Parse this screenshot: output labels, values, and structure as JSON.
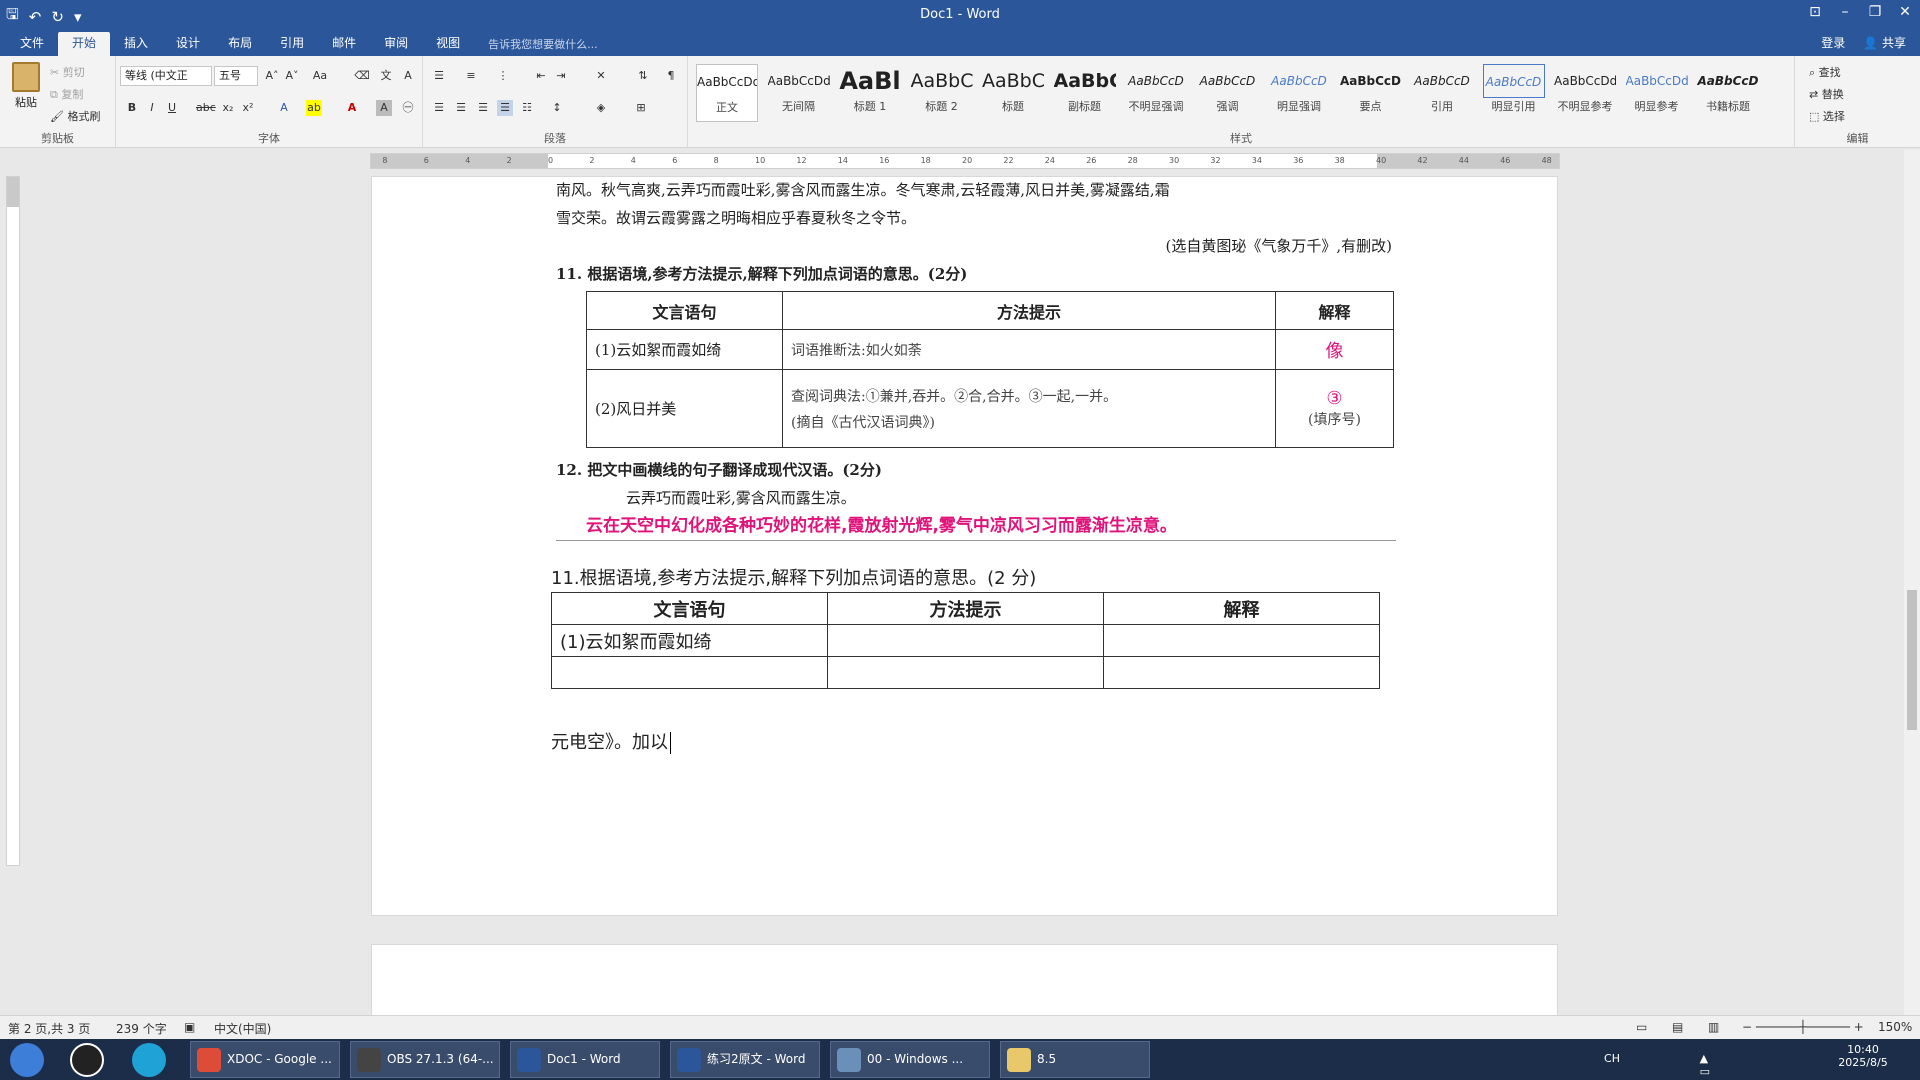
{
  "window": {
    "title": "Doc1 - Word"
  },
  "qat": {
    "save": "🖫",
    "undo": "↶",
    "redo": "↻",
    "more": "▾"
  },
  "win_controls": {
    "ribbon_opt": "⊡",
    "min": "–",
    "restore": "❐",
    "close": "✕"
  },
  "tabs": [
    "文件",
    "开始",
    "插入",
    "设计",
    "布局",
    "引用",
    "邮件",
    "审阅",
    "视图"
  ],
  "active_tab": "开始",
  "tell_me": "告诉我您想要做什么...",
  "account": {
    "signin": "登录",
    "share": "共享"
  },
  "clipboard": {
    "paste": "粘贴",
    "cut": "剪切",
    "copy": "复制",
    "painter": "格式刷",
    "label": "剪贴板"
  },
  "font": {
    "name": "等线 (中文正",
    "size": "五号",
    "label": "字体"
  },
  "paragraph": {
    "label": "段落"
  },
  "styles": {
    "label": "样式",
    "items": [
      {
        "preview": "AaBbCcDd",
        "name": "正文"
      },
      {
        "preview": "AaBbCcDd",
        "name": "无间隔"
      },
      {
        "preview": "AaBl",
        "name": "标题 1"
      },
      {
        "preview": "AaBbC",
        "name": "标题 2"
      },
      {
        "preview": "AaBbC",
        "name": "标题"
      },
      {
        "preview": "AaBbC",
        "name": "副标题"
      },
      {
        "preview": "AaBbCcD",
        "name": "不明显强调"
      },
      {
        "preview": "AaBbCcD",
        "name": "强调"
      },
      {
        "preview": "AaBbCcD",
        "name": "明显强调"
      },
      {
        "preview": "AaBbCcD",
        "name": "要点"
      },
      {
        "preview": "AaBbCcD",
        "name": "引用"
      },
      {
        "preview": "AaBbCcD",
        "name": "明显引用"
      },
      {
        "preview": "AaBbCcDd",
        "name": "不明显参考"
      },
      {
        "preview": "AaBbCcDd",
        "name": "明显参考"
      },
      {
        "preview": "AaBbCcD",
        "name": "书籍标题"
      }
    ]
  },
  "editing": {
    "find": "查找",
    "replace": "替换",
    "select": "选择",
    "label": "编辑"
  },
  "scan": {
    "line1": "南风。秋气高爽,云弄巧而霞吐彩,雾含风而露生凉。冬气寒肃,云轻霞薄,风日并美,雾凝露结,霜",
    "line2": "雪交荣。故谓云霞雾露之明晦相应乎春夏秋冬之令节。",
    "source": "(选自黄图珌《气象万千》,有删改)",
    "q11": "11. 根据语境,参考方法提示,解释下列加点词语的意思。(2分)",
    "table": {
      "headers": [
        "文言语句",
        "方法提示",
        "解释"
      ],
      "row1": {
        "sentence": "(1)云如絮而霞如绮",
        "hint": "词语推断法:如火如荼",
        "answer": "像"
      },
      "row2": {
        "sentence": "(2)风日并美",
        "hint": "查阅词典法:①兼并,吞并。②合,合并。③一起,一并。",
        "hint2": "(摘自《古代汉语词典》)",
        "answer": "③",
        "answer_note": "(填序号)"
      }
    },
    "q12": "12. 把文中画横线的句子翻译成现代汉语。(2分)",
    "q12_sentence": "云弄巧而霞吐彩,雾含风而露生凉。",
    "q12_answer": "云在天空中幻化成各种巧妙的花样,霞放射光辉,雾气中凉风习习而露渐生凉意。"
  },
  "typed": {
    "question": "11.根据语境,参考方法提示,解释下列加点词语的意思。(2 分)",
    "headers": [
      "文言语句",
      "方法提示",
      "解释"
    ],
    "row1_sentence": "(1)云如絮而霞如绮",
    "after": "元电空》。加以"
  },
  "status": {
    "page": "第 2 页,共 3 页",
    "words": "239 个字",
    "lang": "中文(中国)",
    "zoom": "150%"
  },
  "taskbar": {
    "items": [
      {
        "label": "XDOC - Google ...",
        "color": "#dd4b39"
      },
      {
        "label": "OBS 27.1.3 (64-...",
        "color": "#444444"
      },
      {
        "label": "Doc1 - Word",
        "color": "#2b579a"
      },
      {
        "label": "练习2原文 - Word",
        "color": "#2b579a"
      },
      {
        "label": "00 - Windows ...",
        "color": "#6a8fb8"
      },
      {
        "label": "8.5",
        "color": "#e8c86a"
      }
    ],
    "tray": {
      "ime": "CH",
      "time": "10:40",
      "date": "2025/8/5"
    }
  }
}
